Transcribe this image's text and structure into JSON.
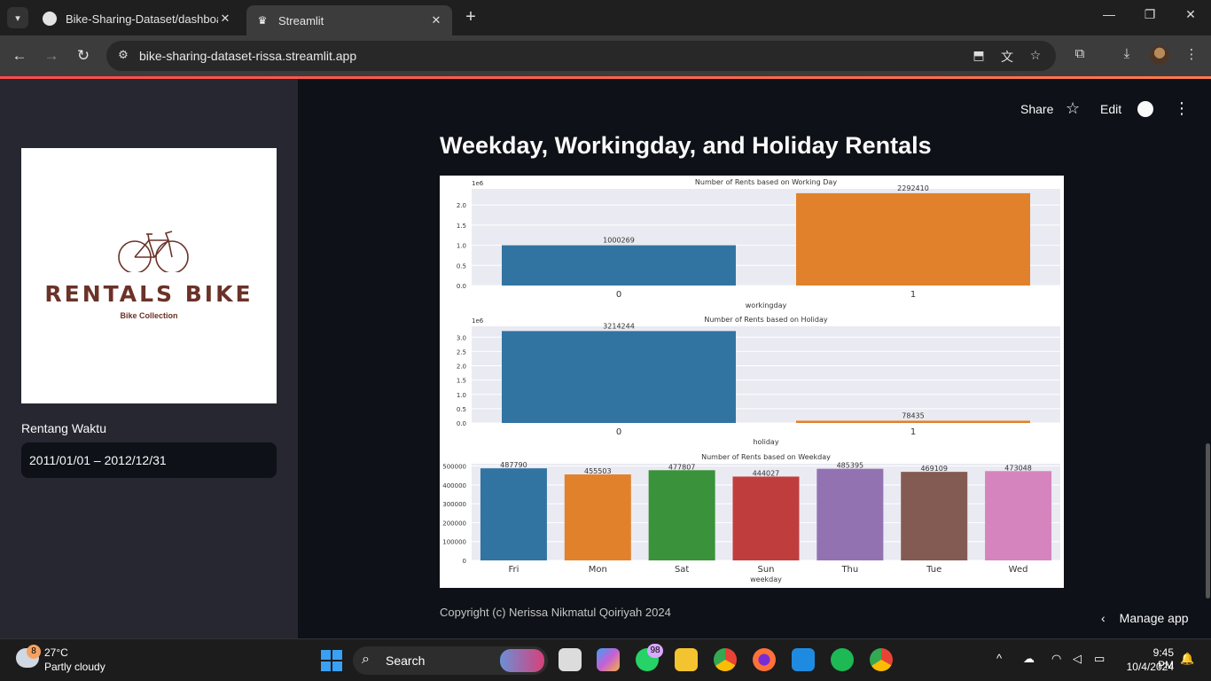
{
  "browser": {
    "tabs": [
      {
        "title": "Bike-Sharing-Dataset/dashboard"
      },
      {
        "title": "Streamlit"
      }
    ],
    "url": "bike-sharing-dataset-rissa.streamlit.app"
  },
  "header": {
    "share": "Share",
    "edit": "Edit"
  },
  "sidebar": {
    "logo_title": "RENTALS BIKE",
    "logo_subtitle": "Bike Collection",
    "date_label": "Rentang Waktu",
    "date_value": "2011/01/01 – 2012/12/31"
  },
  "main": {
    "title": "Weekday, Workingday, and Holiday Rentals",
    "copyright": "Copyright (c) Nerissa Nikmatul Qoiriyah 2024",
    "manage_app": "Manage app"
  },
  "chart_data": [
    {
      "type": "bar",
      "title": "Number of Rents based on Working Day",
      "xlabel": "workingday",
      "ylabel": "",
      "y_scale_label": "1e6",
      "categories": [
        "0",
        "1"
      ],
      "values": [
        1000269,
        2292410
      ],
      "colors": [
        "#3274a1",
        "#e1812c"
      ],
      "ylim": [
        0,
        2400000
      ],
      "yticks": [
        "0.0",
        "0.5",
        "1.0",
        "1.5",
        "2.0"
      ]
    },
    {
      "type": "bar",
      "title": "Number of Rents based on Holiday",
      "xlabel": "holiday",
      "ylabel": "",
      "y_scale_label": "1e6",
      "categories": [
        "0",
        "1"
      ],
      "values": [
        3214244,
        78435
      ],
      "colors": [
        "#3274a1",
        "#e1812c"
      ],
      "ylim": [
        0,
        3380000
      ],
      "yticks": [
        "0.0",
        "0.5",
        "1.0",
        "1.5",
        "2.0",
        "2.5",
        "3.0"
      ]
    },
    {
      "type": "bar",
      "title": "Number of Rents based on Weekday",
      "xlabel": "weekday",
      "ylabel": "",
      "categories": [
        "Fri",
        "Mon",
        "Sat",
        "Sun",
        "Thu",
        "Tue",
        "Wed"
      ],
      "values": [
        487790,
        455503,
        477807,
        444027,
        485395,
        469109,
        473048
      ],
      "colors": [
        "#3274a1",
        "#e1812c",
        "#3a923a",
        "#c03d3e",
        "#9372b2",
        "#845b53",
        "#d684bd"
      ],
      "ylim": [
        0,
        512000
      ],
      "yticks": [
        "0",
        "100000",
        "200000",
        "300000",
        "400000",
        "500000"
      ]
    }
  ],
  "taskbar": {
    "weather_temp": "27°C",
    "weather_desc": "Partly cloudy",
    "weather_badge": "8",
    "search": "Search",
    "whatsapp_badge": "98",
    "time": "9:45 PM",
    "date": "10/4/2024"
  }
}
